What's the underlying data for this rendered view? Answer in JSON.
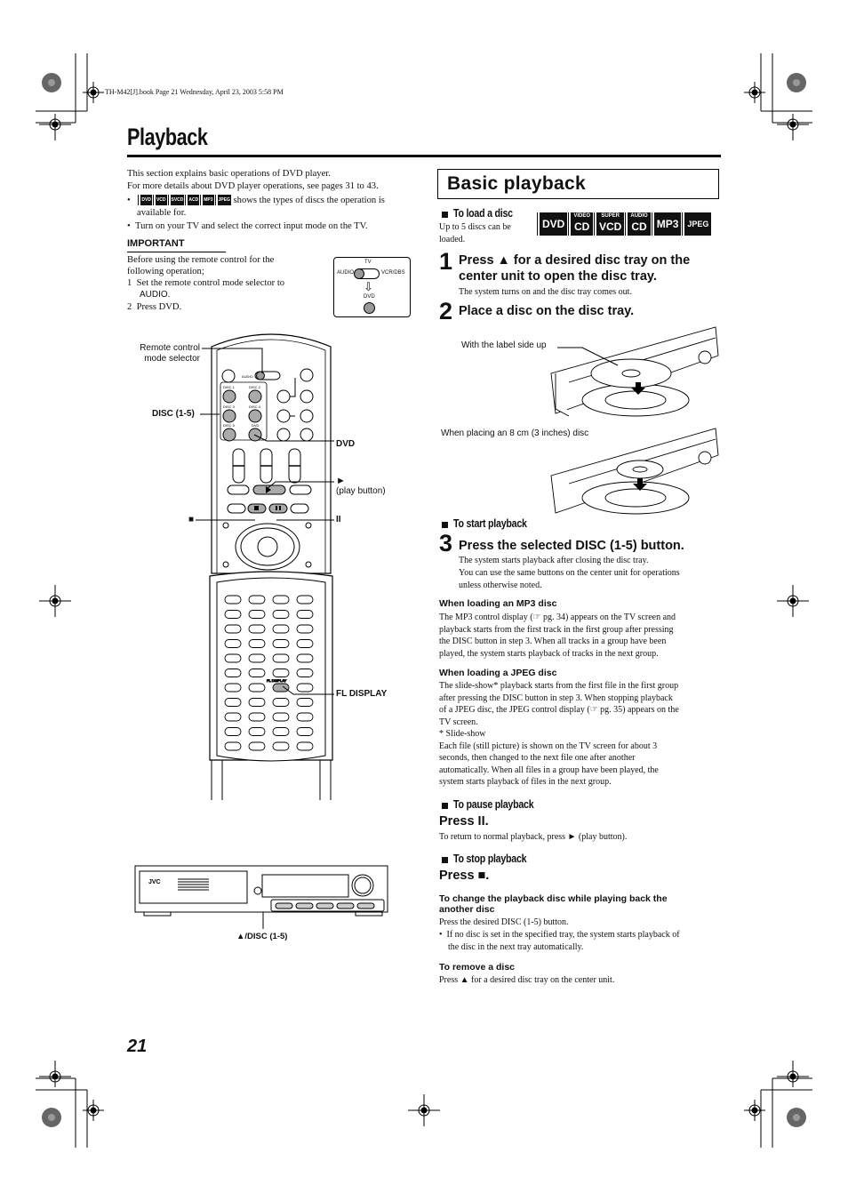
{
  "header": {
    "book_info": "TH-M42[J].book  Page 21  Wednesday, April 23, 2003  5:58 PM"
  },
  "page": {
    "title": "Playback",
    "number": "21"
  },
  "intro": {
    "line1": "This section explains basic operations of DVD player.",
    "line2": "For more details about DVD player operations, see pages 31 to 43.",
    "bullet1_text": "shows the types of discs the operation is",
    "bullet1_cont": "available for.",
    "bullet2": "Turn on your TV and select the correct input mode on the TV.",
    "bullet_char": "•"
  },
  "important": {
    "heading": "IMPORTANT",
    "line1": "Before using the remote control for the",
    "line2": "following operation;",
    "step1_num": "1",
    "step1_text": "Set the remote control mode selector to",
    "step1_cont": "AUDIO.",
    "step2_num": "2",
    "step2_text": "Press DVD."
  },
  "selector_box": {
    "tv_label": "TV",
    "audio_label": "AUDIO",
    "vcr_label": "VCR/DBS",
    "dvd_label": "DVD"
  },
  "disc_types": [
    {
      "top": "",
      "bottom": "DVD"
    },
    {
      "top": "VIDEO",
      "bottom": "CD"
    },
    {
      "top": "SUPER",
      "bottom": "VCD"
    },
    {
      "top": "AUDIO",
      "bottom": "CD"
    },
    {
      "top": "",
      "bottom": "MP3"
    },
    {
      "top": "",
      "bottom": "JPEG"
    }
  ],
  "remote_callouts": {
    "mode_selector": "Remote control mode selector",
    "mode_selector_l1": "Remote control",
    "mode_selector_l2": "mode selector",
    "disc": "DISC (1-5)",
    "dvd": "DVD",
    "play_symbol": "►",
    "play_label": "(play button)",
    "stop_symbol": "■",
    "pause_symbol": "II",
    "fl_display": "FL DISPLAY",
    "fl_display_small": "FL DISPLAY",
    "audio_small": "AUDIO",
    "disc_btns": [
      "DISC 1",
      "DISC 2",
      "DISC 3",
      "DISC 4",
      "DISC 5",
      "DVD"
    ]
  },
  "center_unit": {
    "brand": "JVC",
    "callout": "▲/DISC (1-5)"
  },
  "basic": {
    "heading": "Basic playback",
    "load": {
      "heading": "To load a disc",
      "note_l1": "Up to 5 discs can be",
      "note_l2": "loaded."
    },
    "step1": {
      "num": "1",
      "line1": "Press ▲ for a desired disc tray on the",
      "line2": "center unit to open the disc tray.",
      "note": "The system turns on and the disc tray comes out."
    },
    "step2": {
      "num": "2",
      "line1": "Place a disc on the disc tray."
    },
    "illustration": {
      "label_side": "With the label side up",
      "small_disc": "When placing an 8 cm (3 inches) disc"
    },
    "start": {
      "heading": "To start playback"
    },
    "step3": {
      "num": "3",
      "line1": "Press the selected DISC (1-5) button.",
      "note1": "The system starts playback after closing the disc tray.",
      "note2": "You can use the same buttons on the center unit for operations",
      "note3": "unless otherwise noted."
    },
    "mp3": {
      "heading": "When loading an MP3 disc",
      "lines": [
        "The MP3 control display (☞ pg. 34) appears on the TV screen and",
        "playback starts from the first track in the first group after pressing",
        "the DISC button in step 3. When all tracks in a group have been",
        "played, the system starts playback of tracks in the next group."
      ]
    },
    "jpeg": {
      "heading": "When loading a JPEG disc",
      "lines": [
        "The slide-show* playback starts from the first file in the first group",
        "after pressing the DISC button in step 3. When stopping playback",
        "of a JPEG disc, the JPEG control display (☞ pg. 35) appears on the",
        "TV screen.",
        "*  Slide-show",
        "Each file (still picture) is shown on the TV screen for about 3",
        "seconds, then changed to the next file one after another",
        "automatically. When all files in a group have been played, the",
        "system starts playback of files in the next group."
      ]
    },
    "pause": {
      "heading": "To pause playback",
      "press": "Press II.",
      "note": "To return to normal playback, press ► (play button)."
    },
    "stop": {
      "heading": "To stop playback",
      "press": "Press ■."
    },
    "change": {
      "heading_l1": "To change the playback disc while playing back the",
      "heading_l2": "another disc",
      "line1": "Press the desired DISC (1-5) button.",
      "bullet_l1": "If no disc is set in the specified tray, the system starts playback of",
      "bullet_l2": "the disc in the next tray automatically."
    },
    "remove": {
      "heading": "To remove a disc",
      "line1": "Press ▲ for a desired disc tray on the center unit."
    }
  }
}
